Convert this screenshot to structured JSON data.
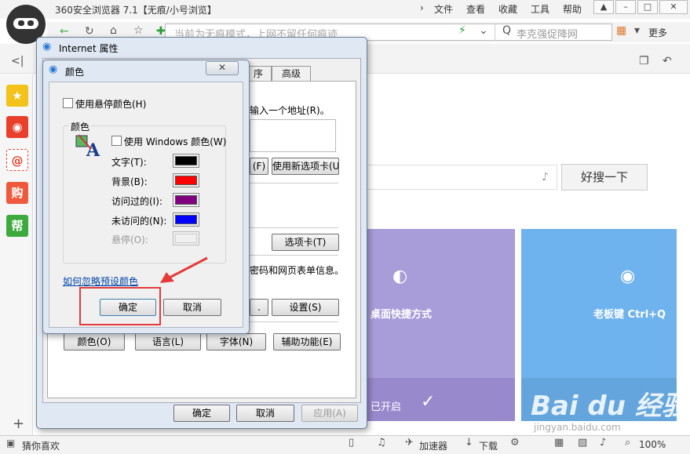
{
  "browser": {
    "title": "360安全浏览器 7.1【无痕/小号浏览】",
    "menu": [
      "文件",
      "查看",
      "收藏",
      "工具",
      "帮助"
    ],
    "address_placeholder": "当前为无痕模式，上网不留任何痕迹",
    "search_text": "李克强促降网",
    "more_label": "更多",
    "search_button": "好搜一下",
    "tile_left_label": "桌面快捷方式",
    "tile_left_foot": "已开启",
    "tile_right_label": "老板键 Ctrl+Q",
    "status": {
      "left": "猜你喜欢",
      "accelerator": "加速器",
      "download": "下载",
      "zoom": "100%"
    },
    "watermark": "Bai du 经验",
    "watermark_sub": "jingyan.baidu.com"
  },
  "inet_dialog": {
    "title": "Internet 属性",
    "tabs": [
      "序",
      "高级"
    ],
    "home_hint": "输入一个地址(R)。",
    "btn_current": "(F)",
    "btn_new_tab": "使用新选项卡(U)",
    "btn_tabs": "选项卡(T)",
    "history_hint": "密码和网页表单信息。",
    "btn_dots": ".",
    "btn_settings": "设置(S)",
    "btn_colors": "颜色(O)",
    "btn_languages": "语言(L)",
    "btn_fonts": "字体(N)",
    "btn_accessibility": "辅助功能(E)",
    "btn_ok": "确定",
    "btn_cancel": "取消",
    "btn_apply": "应用(A)"
  },
  "colors_dialog": {
    "title": "颜色",
    "use_hover_label": "使用悬停颜色(H)",
    "group_label": "颜色",
    "use_windows_label": "使用 Windows 颜色(W)",
    "rows": [
      {
        "label": "文字(T):",
        "color": "#000000"
      },
      {
        "label": "背景(B):",
        "color": "#ff0000"
      },
      {
        "label": "访问过的(I):",
        "color": "#800080"
      },
      {
        "label": "未访问的(N):",
        "color": "#0000ff"
      },
      {
        "label": "悬停(O):",
        "color": "#f0f0f0"
      }
    ],
    "link": "如何忽略预设颜色",
    "ok": "确定",
    "cancel": "取消"
  },
  "colors": {
    "highlight": "#e53a3a",
    "tile_purple": "#a89cd9",
    "tile_blue": "#6fb3ee"
  }
}
